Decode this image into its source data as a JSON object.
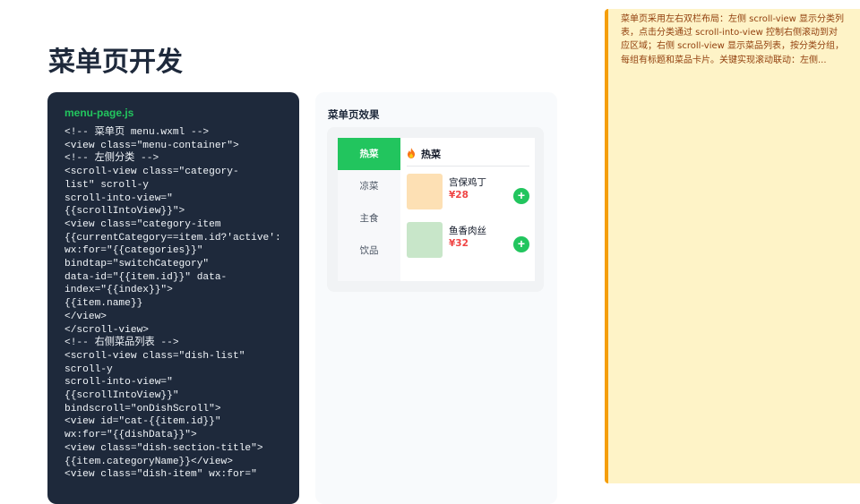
{
  "page": {
    "title": "菜单页开发"
  },
  "code": {
    "filename": "menu-page.js",
    "content": "<!-- 菜单页 menu.wxml -->\n<view class=\"menu-container\">\n<!-- 左侧分类 -->\n<scroll-view class=\"category-\nlist\" scroll-y\nscroll-into-view=\"\n{{scrollIntoView}}\">\n<view class=\"category-item\n{{currentCategory==item.id?'active':\nwx:for=\"{{categories}}\"\nbindtap=\"switchCategory\"\ndata-id=\"{{item.id}}\" data-\nindex=\"{{index}}\">\n{{item.name}}\n</view>\n</scroll-view>\n<!-- 右侧菜品列表 -->\n<scroll-view class=\"dish-list\"\nscroll-y\nscroll-into-view=\"\n{{scrollIntoView}}\"\nbindscroll=\"onDishScroll\">\n<view id=\"cat-{{item.id}}\"\nwx:for=\"{{dishData}}\">\n<view class=\"dish-section-title\">\n{{item.categoryName}}</view>\n<view class=\"dish-item\" wx:for=\""
  },
  "preview": {
    "title": "菜单页效果",
    "categories": [
      "热菜",
      "凉菜",
      "主食",
      "饮品"
    ],
    "active_category": "热菜",
    "section": {
      "title": "热菜",
      "icon": "fire-icon"
    },
    "dishes": [
      {
        "name": "宫保鸡丁",
        "price": "¥28",
        "thumb_color": "#fde0b4"
      },
      {
        "name": "鱼香肉丝",
        "price": "¥32",
        "thumb_color": "#c8e6c9"
      }
    ],
    "add_label": "+"
  },
  "note": {
    "text": "菜单页采用左右双栏布局：左侧 scroll-view 显示分类列表，点击分类通过 scroll-into-view 控制右侧滚动到对应区域；右侧 scroll-view 显示菜品列表，按分类分组，每组有标题和菜品卡片。关键实现滚动联动：左侧..."
  },
  "colors": {
    "accent": "#22c55e",
    "price": "#ef4444",
    "code_bg": "#1e293b",
    "note_bg": "#fef3c7",
    "note_border": "#f59e0b"
  }
}
